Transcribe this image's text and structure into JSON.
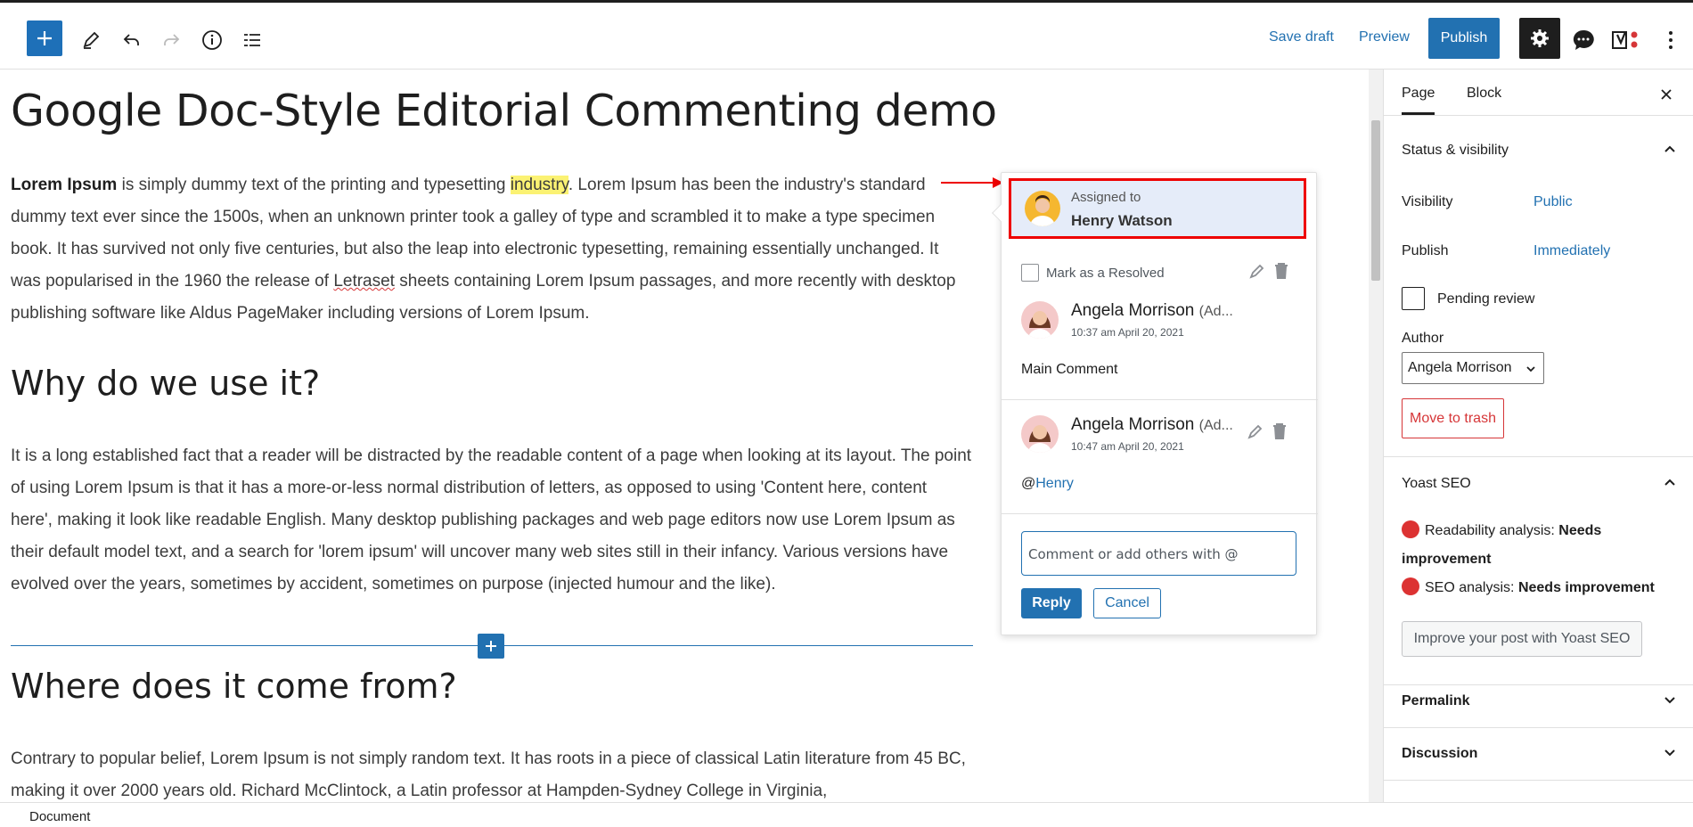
{
  "toolbar": {
    "save_draft": "Save draft",
    "preview": "Preview",
    "publish": "Publish"
  },
  "editor": {
    "title": "Google Doc-Style Editorial Commenting demo",
    "p1_lead": "Lorem Ipsum",
    "p1_a": " is simply dummy text of the printing and typesetting ",
    "p1_highlight": "industry",
    "p1_b": ". Lorem Ipsum has been the industry's standard dummy text ever since the 1500s, when an unknown printer took a galley of type and scrambled it to make a type specimen book. It has survived not only five centuries, but also the leap into electronic typesetting, remaining essentially unchanged. It was popularised in the 1960 the release of ",
    "p1_misspelled": "Letraset",
    "p1_c": " sheets containing Lorem Ipsum passages, and more recently with desktop publishing software like Aldus PageMaker including versions of Lorem Ipsum.",
    "h2_1": "Why do we use it?",
    "p2": "It is a long established fact that a reader will be distracted by the readable content of a page when looking at its layout. The point of using Lorem Ipsum is that it has a more-or-less normal distribution of letters, as opposed to using 'Content here, content here', making it look like readable English. Many desktop publishing packages and web page editors now use Lorem Ipsum as their default model text, and a search for 'lorem ipsum' will uncover many web sites still in their infancy. Various versions have evolved over the years, sometimes by accident, sometimes on purpose (injected humour and the like).",
    "h2_2": "Where does it come from?",
    "p3": "Contrary to popular belief, Lorem Ipsum is not simply random text. It has roots in a piece of classical Latin literature from 45 BC, making it over 2000 years old. Richard McClintock, a Latin professor at Hampden-Sydney College in Virginia,"
  },
  "comment_popup": {
    "assigned_label": "Assigned to",
    "assigned_name": "Henry Watson",
    "resolve_label": "Mark as a Resolved",
    "comments": [
      {
        "author": "Angela Morrison",
        "role": "(Ad...",
        "time": "10:37 am April 20, 2021",
        "text": "Main Comment"
      },
      {
        "author": "Angela Morrison",
        "role": "(Ad...",
        "time": "10:47 am April 20, 2021",
        "text_prefix": "@",
        "mention": "Henry"
      }
    ],
    "reply_placeholder": "Comment or add others with @",
    "reply_button": "Reply",
    "cancel_button": "Cancel"
  },
  "sidebar": {
    "tabs": [
      "Page",
      "Block"
    ],
    "status_visibility": {
      "heading": "Status & visibility",
      "visibility_label": "Visibility",
      "visibility_value": "Public",
      "publish_label": "Publish",
      "publish_value": "Immediately",
      "pending_review": "Pending review",
      "author_label": "Author",
      "author_value": "Angela Morrison",
      "trash_button": "Move to trash"
    },
    "yoast": {
      "heading": "Yoast SEO",
      "readability_label": "Readability analysis: ",
      "readability_value": "Needs improvement",
      "seo_label": "SEO analysis: ",
      "seo_value": "Needs improvement",
      "improve_button": "Improve your post with Yoast SEO"
    },
    "permalink": "Permalink",
    "discussion": "Discussion"
  },
  "footer": {
    "breadcrumb": "Document"
  },
  "colors": {
    "accent": "#2271b1",
    "highlight": "#fbf273",
    "alert": "#d63638"
  }
}
